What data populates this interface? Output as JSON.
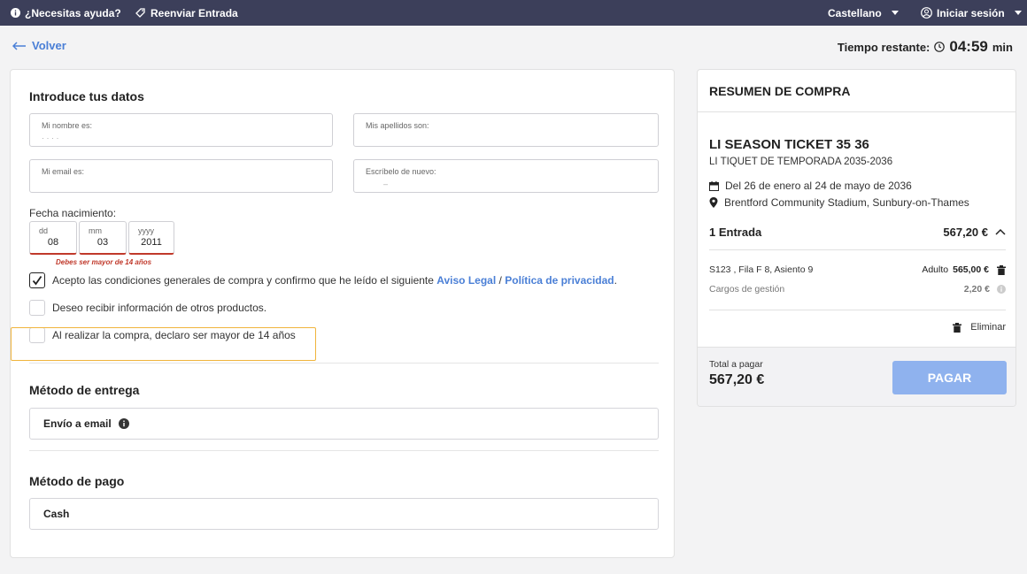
{
  "topbar": {
    "help_label": "¿Necesitas ayuda?",
    "resend_label": "Reenviar Entrada",
    "language_label": "Castellano",
    "login_label": "Iniciar sesión"
  },
  "nav": {
    "back_label": "Volver",
    "timer_label": "Tiempo restante:",
    "timer_value": "04:59",
    "timer_unit": "min"
  },
  "form": {
    "title": "Introduce tus datos",
    "name_label": "Mi nombre es:",
    "name_value": "· · · ·",
    "surname_label": "Mis apellidos son:",
    "surname_value": "",
    "email_label": "Mi email es:",
    "email_value": "",
    "email_repeat_label": "Escríbelo de nuevo:",
    "email_repeat_value": "–",
    "dob_label": "Fecha nacimiento:",
    "dob": {
      "day_label": "dd",
      "day_value": "08",
      "month_label": "mm",
      "month_value": "03",
      "year_label": "yyyy",
      "year_value": "2011"
    },
    "dob_error": "Debes ser mayor de 14 años",
    "terms_prefix": "Acepto las condiciones generales de compra y confirmo que he leído el siguiente",
    "terms_link_legal": "Aviso Legal",
    "terms_sep": "/",
    "terms_link_privacy": "Política de privacidad",
    "terms_suffix": ".",
    "terms_checked": true,
    "newsletter_label": "Deseo recibir información de otros productos.",
    "newsletter_checked": false,
    "age_label": "Al realizar la compra, declaro ser mayor de 14 años",
    "age_checked": false,
    "highlight_color": "#f0b43c"
  },
  "delivery": {
    "title": "Método de entrega",
    "option": "Envío a email"
  },
  "payment": {
    "title": "Método de pago",
    "option": "Cash"
  },
  "summary": {
    "title": "RESUMEN DE COMPRA",
    "event_name": "LI SEASON TICKET 35 36",
    "event_subtitle": "LI TIQUET DE TEMPORADA 2035-2036",
    "dates": "Del 26 de enero al 24 de mayo de 2036",
    "venue": "Brentford Community Stadium, Sunbury-on-Thames",
    "tickets_label": "1 Entrada",
    "tickets_total": "567,20 €",
    "seat": "S123 , Fila F 8, Asiento 9",
    "ticket_type": "Adulto",
    "ticket_price": "565,00 €",
    "fees_label": "Cargos de gestión",
    "fees_value": "2,20 €",
    "delete_label": "Eliminar",
    "total_label": "Total a pagar",
    "total_value": "567,20 €",
    "pay_label": "PAGAR",
    "accent_color": "#4a7fd6"
  }
}
